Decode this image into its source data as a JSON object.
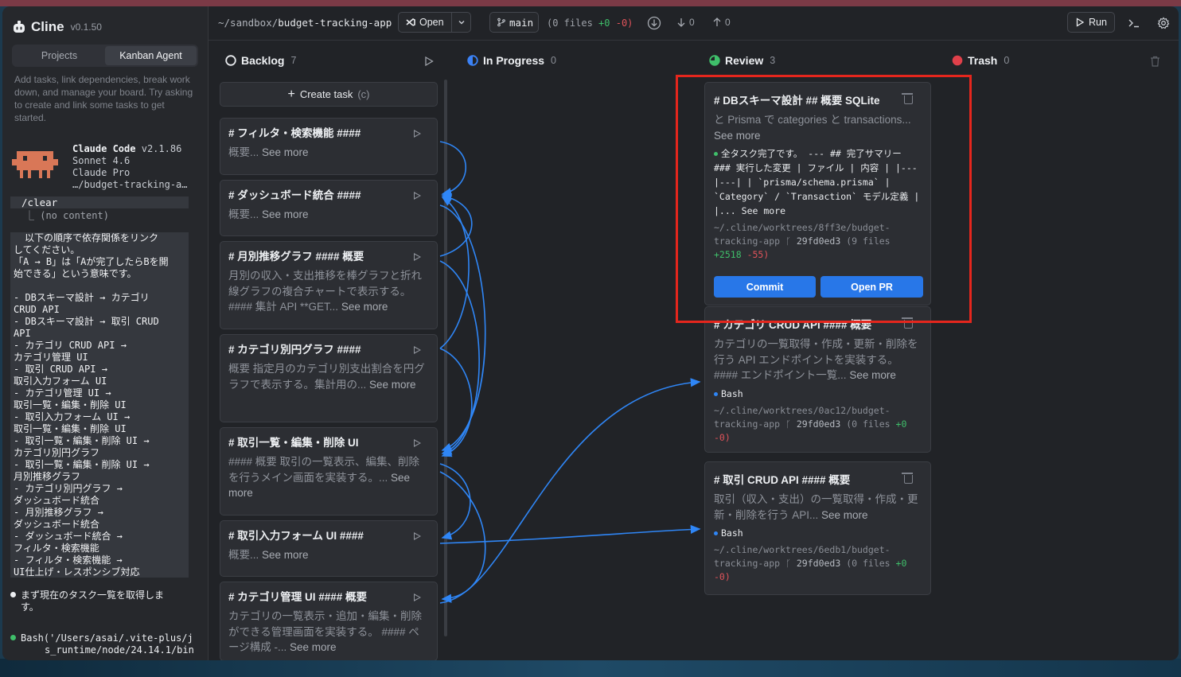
{
  "app": {
    "name": "Cline",
    "version": "v0.1.50"
  },
  "sidebar": {
    "tabs": [
      "Projects",
      "Kanban Agent"
    ],
    "help_text": "Add tasks, link dependencies, break work down, and manage your board. Try asking to create and link some tasks to get started.",
    "agent": {
      "name": "Claude Code",
      "version": "v2.1.86",
      "model": "Sonnet 4.6",
      "plan": "Claude Pro",
      "path": "…/budget-tracking-a…"
    },
    "command": "/clear",
    "command_output": "⎿ (no content)",
    "prompt_lines": [
      "以下の順序で依存関係をリンク",
      "してください。",
      "「A → B」は「Aが完了したらBを開",
      "始できる」という意味です。",
      "",
      "- DBスキーマ設計 → カテゴリ",
      "CRUD API",
      "- DBスキーマ設計 → 取引 CRUD",
      "API",
      "- カテゴリ CRUD API →",
      "カテゴリ管理 UI",
      "- 取引 CRUD API →",
      "取引入力フォーム UI",
      "- カテゴリ管理 UI →",
      "取引一覧・編集・削除 UI",
      "- 取引入力フォーム UI →",
      "取引一覧・編集・削除 UI",
      "- 取引一覧・編集・削除 UI →",
      "カテゴリ別円グラフ",
      "- 取引一覧・編集・削除 UI →",
      "月別推移グラフ",
      "- カテゴリ別円グラフ →",
      "ダッシュボード統合",
      "- 月別推移グラフ →",
      "ダッシュボード統合",
      "- ダッシュボード統合 →",
      "フィルタ・検索機能",
      "- フィルタ・検索機能 →",
      "UI仕上げ・レスポンシブ対応"
    ],
    "status_line": "まず現在のタスク一覧を取得しま",
    "status_line2": "す。",
    "bash_line": "Bash('/Users/asai/.vite-plus/j",
    "bash_line2": "s_runtime/node/24.14.1/bin"
  },
  "topbar": {
    "path_prefix": "~/sandbox/",
    "path_name": "budget-tracking-app",
    "open_label": "Open",
    "branch": "main",
    "files_text": "(0 files",
    "files_plus": "+0",
    "files_minus": "-0)",
    "pull_count": "0",
    "push_count": "0",
    "run_label": "Run"
  },
  "columns": {
    "backlog": {
      "title": "Backlog",
      "count": "7",
      "create_label": "Create task",
      "create_shortcut": "(c)"
    },
    "in_progress": {
      "title": "In Progress",
      "count": "0"
    },
    "review": {
      "title": "Review",
      "count": "3"
    },
    "trash": {
      "title": "Trash",
      "count": "0"
    }
  },
  "backlog_cards": [
    {
      "title": "# フィルタ・検索機能 ####",
      "desc": "概要...",
      "more": "See more"
    },
    {
      "title": "# ダッシュボード統合 ####",
      "desc": "概要...",
      "more": "See more"
    },
    {
      "title": "# 月別推移グラフ #### 概要",
      "desc": "月別の収入・支出推移を棒グラフと折れ線グラフの複合チャートで表示する。 #### 集計 API **GET...",
      "more": "See more"
    },
    {
      "title": "# カテゴリ別円グラフ ####",
      "desc": "概要 指定月のカテゴリ別支出割合を円グラフで表示する。集計用の...",
      "more": "See more"
    },
    {
      "title": "# 取引一覧・編集・削除 UI",
      "desc": "#### 概要 取引の一覧表示、編集、削除を行うメイン画面を実装する。...",
      "more": "See more"
    },
    {
      "title": "# 取引入力フォーム UI ####",
      "desc": "概要...",
      "more": "See more"
    },
    {
      "title": "# カテゴリ管理 UI #### 概要",
      "desc": "カテゴリの一覧表示・追加・編集・削除ができる管理画面を実装する。 #### ページ構成 -...",
      "more": "See more"
    }
  ],
  "review_cards": [
    {
      "title": "# DBスキーマ設計 ## 概要 SQLite",
      "desc": "と Prisma で categories と transactions...",
      "more": "See more",
      "status": "全タスク完了です。 --- ## 完了サマリー ### 実行した変更 | ファイル | 内容 | |---|---| | `prisma/schema.prisma` | `Category` / `Transaction` モデル定義 | |...",
      "status_more": "See more",
      "worktree": "~/.cline/worktrees/8ff3e/budget-tracking-app",
      "commit": "29fd0ed3",
      "files": "(9 files",
      "plus": "+2518",
      "minus": "-55)",
      "commit_label": "Commit",
      "pr_label": "Open PR"
    },
    {
      "title": "# カテゴリ CRUD API #### 概要",
      "desc": "カテゴリの一覧取得・作成・更新・削除を行う API エンドポイントを実装する。 #### エンドポイント一覧...",
      "more": "See more",
      "status": "Bash",
      "worktree": "~/.cline/worktrees/0ac12/budget-tracking-app",
      "commit": "29fd0ed3",
      "files": "(0 files",
      "plus": "+0",
      "minus": "-0)"
    },
    {
      "title": "# 取引 CRUD API #### 概要",
      "desc": "取引（収入・支出）の一覧取得・作成・更新・削除を行う API...",
      "more": "See more",
      "status": "Bash",
      "worktree": "~/.cline/worktrees/6edb1/budget-tracking-app",
      "commit": "29fd0ed3",
      "files": "(0 files",
      "plus": "+0",
      "minus": "-0)"
    }
  ],
  "colors": {
    "accent": "#2877e8",
    "highlight": "#e5261d",
    "review": "#3fbf6a",
    "trash": "#e0404a",
    "progress": "#3b82f6"
  }
}
